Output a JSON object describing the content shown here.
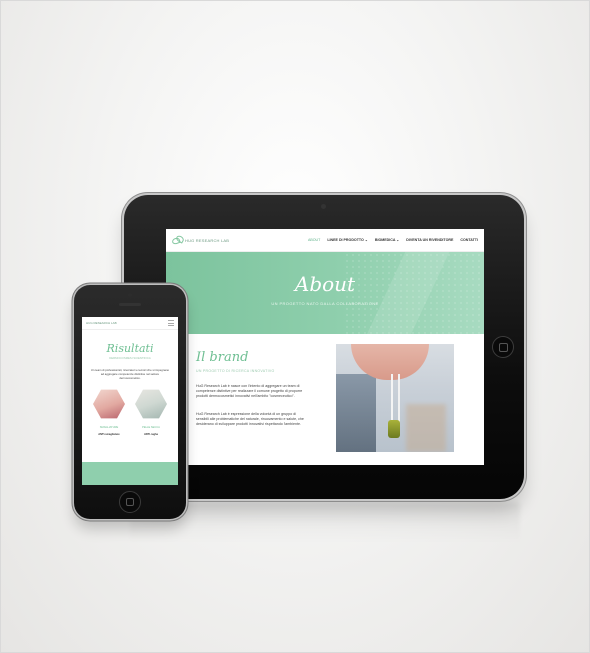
{
  "tablet": {
    "logo_text": "HUG RESEARCH LAB",
    "menu": [
      {
        "label": "ABOUT",
        "active": true
      },
      {
        "label": "LINEE DI PRODOTTO ⌄",
        "active": false
      },
      {
        "label": "BIOMEDICA ⌄",
        "active": false
      },
      {
        "label": "DIVENTA UN RIVENDITORE",
        "active": false
      },
      {
        "label": "CONTATTI",
        "active": false
      }
    ],
    "hero": {
      "title": "About",
      "subtitle": "UN PROGETTO NATO DALLA COLLABORAZIONE"
    },
    "brand": {
      "title": "Il brand",
      "subtitle": "UN PROGETTO DI RICERCA INNOVATIVO",
      "paragraph_1": "HuG Research Lab è nasce con l'intento di aggregare un team di competenze distintive per realizzare il comune progetto di proporre prodotti dermocosmetici innovativi nell'ambito \"cosmeceutico\".",
      "paragraph_2": "HuG Research Lab è espressione della volontà di un gruppo di sensibili alle problematiche del naturale, rinuovamento e salute, che desiderano di sviluppare prodotti innovativi rispettando l'ambiente."
    }
  },
  "phone": {
    "logo_text": "HUG RESEARCH LAB",
    "title": "Risultati",
    "subtitle": "DERMOCOSMESI SCIENTIFICA",
    "paragraph": "Un team di professionisti, ricercatori e tecnici che si impegnano ad aggregare competenze distintive nel settore dermocosmetico.",
    "captions": [
      {
        "line1": "SMAGLIATURE",
        "line2": "ANTI-smagliature"
      },
      {
        "line1": "PELLE SECCA",
        "line2": "ANTI-rughe"
      }
    ]
  }
}
